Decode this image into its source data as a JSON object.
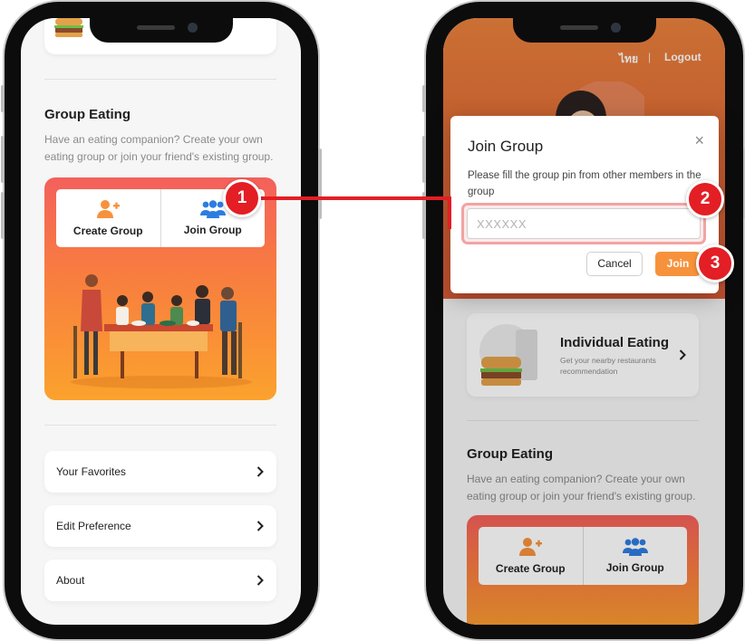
{
  "left_screen": {
    "group_eating": {
      "title": "Group Eating",
      "description": "Have an eating companion? Create your own eating group or join your friend's existing group.",
      "create_group_label": "Create Group",
      "join_group_label": "Join Group"
    },
    "menu": [
      {
        "label": "Your Favorites"
      },
      {
        "label": "Edit Preference"
      },
      {
        "label": "About"
      }
    ]
  },
  "right_screen": {
    "header": {
      "language": "ไทย",
      "separator": "|",
      "logout": "Logout"
    },
    "individual_eating": {
      "title": "Individual Eating",
      "subtitle": "Get your nearby restaurants recommendation"
    },
    "group_eating": {
      "title": "Group Eating",
      "description": "Have an eating companion? Create your own eating group or join your friend's existing group.",
      "create_group_label": "Create Group",
      "join_group_label": "Join Group"
    }
  },
  "modal": {
    "title": "Join Group",
    "close_symbol": "×",
    "description": "Please fill the group pin from other members in the group",
    "pin_placeholder": "XXXXXX",
    "cancel_label": "Cancel",
    "join_label": "Join"
  },
  "callouts": [
    "1",
    "2",
    "3"
  ],
  "colors": {
    "accent_orange": "#f7923c",
    "callout_red": "#e31e24",
    "create_icon": "#f7923c",
    "join_icon": "#2d7de0"
  }
}
